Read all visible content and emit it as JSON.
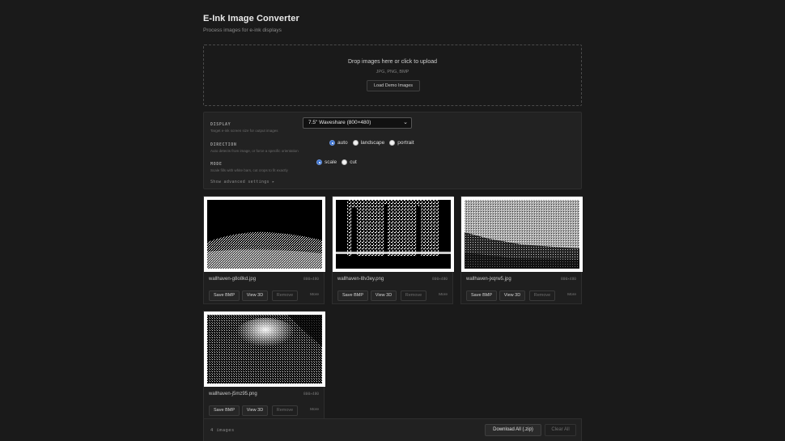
{
  "header": {
    "title": "E-Ink Image Converter",
    "subtitle": "Process images for e-ink displays"
  },
  "dropzone": {
    "title": "Drop images here or click to upload",
    "formats": "JPG, PNG, BMP",
    "demo_label": "Load Demo Images"
  },
  "settings": {
    "display": {
      "label": "DISPLAY",
      "desc": "Target e-ink screen size for output images",
      "selected": "7.5\" Waveshare (800×480)"
    },
    "direction": {
      "label": "DIRECTION",
      "desc": "Auto detects from image, or force a specific orientation",
      "options": [
        "auto",
        "landscape",
        "portrait"
      ],
      "selected": "auto"
    },
    "mode": {
      "label": "MODE",
      "desc": "Scale fills with white bars, cut crops to fit exactly",
      "options": [
        "scale",
        "cut"
      ],
      "selected": "scale"
    },
    "advanced_label": "Show advanced settings ▸"
  },
  "cards": [
    {
      "filename": "wallhaven-g8o8kd.jpg",
      "dims": "800×480",
      "save": "Save BMP",
      "view": "View 3D",
      "remove": "Remove",
      "more": "More"
    },
    {
      "filename": "wallhaven-l8v3ey.png",
      "dims": "800×480",
      "save": "Save BMP",
      "view": "View 3D",
      "remove": "Remove",
      "more": "More"
    },
    {
      "filename": "wallhaven-jxqrw5.jpg",
      "dims": "800×480",
      "save": "Save BMP",
      "view": "View 3D",
      "remove": "Remove",
      "more": "More"
    },
    {
      "filename": "wallhaven-j5mz95.png",
      "dims": "800×480",
      "save": "Save BMP",
      "view": "View 3D",
      "remove": "Remove",
      "more": "More"
    }
  ],
  "footer": {
    "count": "4 images",
    "download_label": "Download All (.zip)",
    "clear_label": "Clear All"
  },
  "colors": {
    "background": "#1a1a1a",
    "panel": "#222222",
    "radio_accent": "#3b73d1"
  }
}
